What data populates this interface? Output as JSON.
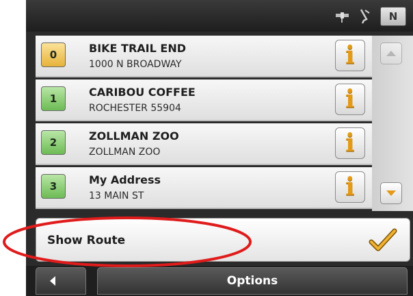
{
  "status_bar": {
    "north_label": "N",
    "icons": [
      "satellite-icon",
      "gps-signal-icon"
    ]
  },
  "destinations": [
    {
      "index": "0",
      "title": "BIKE TRAIL END",
      "subtitle": "1000 N BROADWAY",
      "badge_color": "#e5b339"
    },
    {
      "index": "1",
      "title": "CARIBOU COFFEE",
      "subtitle": "ROCHESTER 55904",
      "badge_color": "#6dbb55"
    },
    {
      "index": "2",
      "title": "ZOLLMAN ZOO",
      "subtitle": "ZOLLMAN ZOO",
      "badge_color": "#6dbb55"
    },
    {
      "index": "3",
      "title": "My Address",
      "subtitle": "13 MAIN ST",
      "badge_color": "#6dbb55"
    }
  ],
  "info_label": "i",
  "show_route": {
    "label": "Show Route"
  },
  "bottom_bar": {
    "options_label": "Options"
  },
  "colors": {
    "highlight": "#e01b1b",
    "info_accent": "#e49a15",
    "check": "#e0a020"
  }
}
